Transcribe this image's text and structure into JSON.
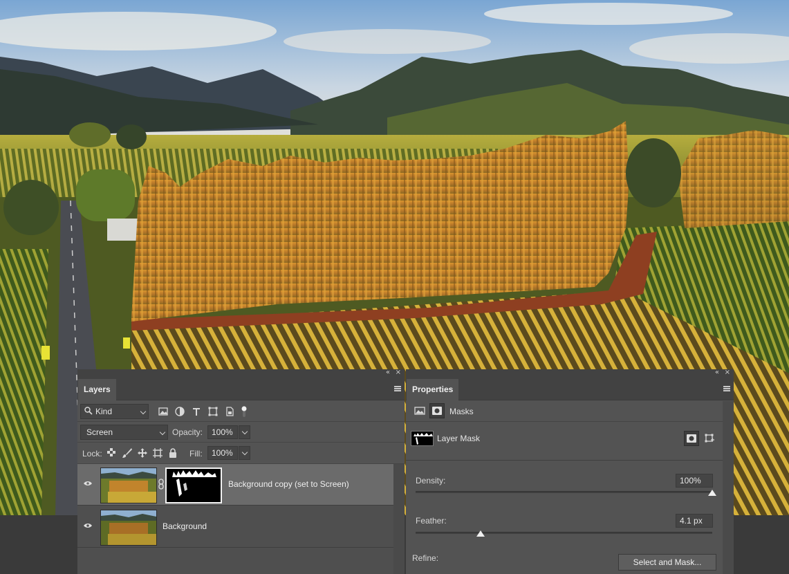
{
  "layers_panel": {
    "tab": "Layers",
    "collapse_glyph": "«",
    "close_glyph": "×",
    "filter": {
      "value": "Kind",
      "icon": "search-icon"
    },
    "filter_icons": [
      "image-filter-icon",
      "adjustment-filter-icon",
      "type-filter-icon",
      "shape-filter-icon",
      "smart-object-filter-icon",
      "filter-toggle-icon"
    ],
    "blend_mode": "Screen",
    "opacity_label": "Opacity:",
    "opacity_value": "100%",
    "lock_label": "Lock:",
    "lock_icons": [
      "lock-transparent-icon",
      "lock-image-icon",
      "lock-position-icon",
      "lock-artboard-icon",
      "lock-all-icon"
    ],
    "fill_label": "Fill:",
    "fill_value": "100%",
    "layers": [
      {
        "name": "Background copy (set to Screen)",
        "selected": true,
        "has_mask": true
      },
      {
        "name": "Background",
        "selected": false,
        "has_mask": false
      }
    ]
  },
  "properties_panel": {
    "tab": "Properties",
    "collapse_glyph": "«",
    "close_glyph": "×",
    "masks_title": "Masks",
    "layer_mask_label": "Layer Mask",
    "density_label": "Density:",
    "density_value": "100%",
    "density_level": 1.0,
    "feather_label": "Feather:",
    "feather_value": "4.1 px",
    "feather_level": 0.22,
    "refine_label": "Refine:",
    "select_and_mask_label": "Select and Mask..."
  },
  "colors": {
    "panel_bg": "#535353",
    "panel_header": "#424242",
    "selected_row": "#6b6b6b"
  }
}
